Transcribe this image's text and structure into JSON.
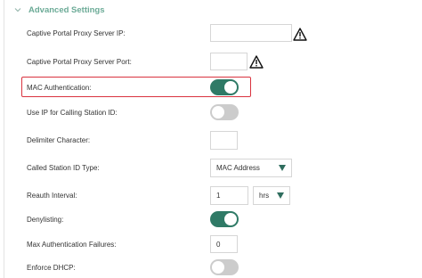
{
  "section": {
    "title": "Advanced Settings",
    "expanded": true
  },
  "fields": {
    "proxy_ip": {
      "label": "Captive Portal Proxy Server IP:",
      "value": ""
    },
    "proxy_port": {
      "label": "Captive Portal Proxy Server Port:",
      "value": ""
    },
    "mac_auth": {
      "label": "MAC Authentication:",
      "on": true
    },
    "use_ip": {
      "label": "Use IP for Calling Station ID:",
      "on": false
    },
    "delimiter": {
      "label": "Delimiter Character:",
      "value": ""
    },
    "called_station": {
      "label": "Called Station ID Type:",
      "value": "MAC Address"
    },
    "reauth": {
      "label": "Reauth Interval:",
      "value": "1",
      "unit": "hrs"
    },
    "denylisting": {
      "label": "Denylisting:",
      "on": true
    },
    "max_failures": {
      "label": "Max Authentication Failures:",
      "value": "0"
    },
    "enforce_dhcp": {
      "label": "Enforce DHCP:",
      "on": false
    }
  },
  "icons": {
    "warning": "warning-icon",
    "chevron": "chevron-down-icon"
  },
  "colors": {
    "accent": "#6cab97",
    "toggle_on": "#2f7a66",
    "toggle_off": "#cccccc",
    "highlight": "#d9333f"
  }
}
